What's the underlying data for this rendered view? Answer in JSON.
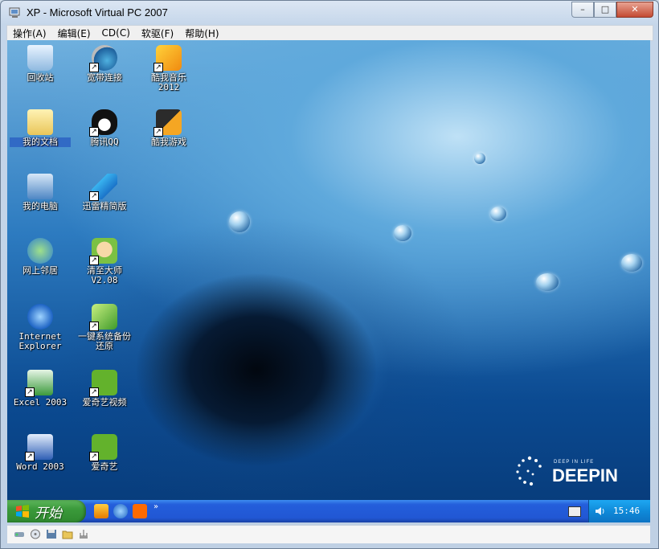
{
  "window": {
    "title": "XP - Microsoft Virtual PC 2007",
    "controls": {
      "minimize": "–",
      "maximize": "□",
      "close": "✕"
    }
  },
  "menubar": {
    "items": [
      "操作(A)",
      "编辑(E)",
      "CD(C)",
      "软驱(F)",
      "帮助(H)"
    ]
  },
  "desktop": {
    "icons": [
      {
        "id": "recycle-bin",
        "label": "回收站",
        "shortcut": false
      },
      {
        "id": "broadband",
        "label": "宽带连接",
        "shortcut": true
      },
      {
        "id": "kuwo-music",
        "label": "酷我音乐\n2012",
        "shortcut": true
      },
      {
        "id": "my-documents",
        "label": "我的文档",
        "shortcut": false
      },
      {
        "id": "qq",
        "label": "腾讯QQ",
        "shortcut": true
      },
      {
        "id": "kuwo-games",
        "label": "酷我游戏",
        "shortcut": true
      },
      {
        "id": "my-computer",
        "label": "我的电脑",
        "shortcut": false
      },
      {
        "id": "xunlei",
        "label": "迅雷精简版",
        "shortcut": true
      },
      {
        "id": "network",
        "label": "网上邻居",
        "shortcut": false
      },
      {
        "id": "cleaner",
        "label": "清至大师\nV2.08",
        "shortcut": true
      },
      {
        "id": "ie",
        "label": "Internet\nExplorer",
        "shortcut": false
      },
      {
        "id": "backup",
        "label": "一键系统备份\n还原",
        "shortcut": true
      },
      {
        "id": "excel",
        "label": "Excel 2003",
        "shortcut": true
      },
      {
        "id": "iqiyi-video",
        "label": "爱奇艺视频",
        "shortcut": true
      },
      {
        "id": "word",
        "label": "Word 2003",
        "shortcut": true
      },
      {
        "id": "iqiyi",
        "label": "爱奇艺",
        "shortcut": true
      }
    ],
    "branding": {
      "tagline": "DEEP IN LIFE",
      "name": "DEEPIN"
    }
  },
  "taskbar": {
    "start_label": "开始",
    "chevron": "»",
    "clock": "15:46"
  },
  "colors": {
    "taskbar_blue": "#245edb",
    "start_green": "#3b9a3b",
    "tray_blue": "#0f8ad9"
  }
}
